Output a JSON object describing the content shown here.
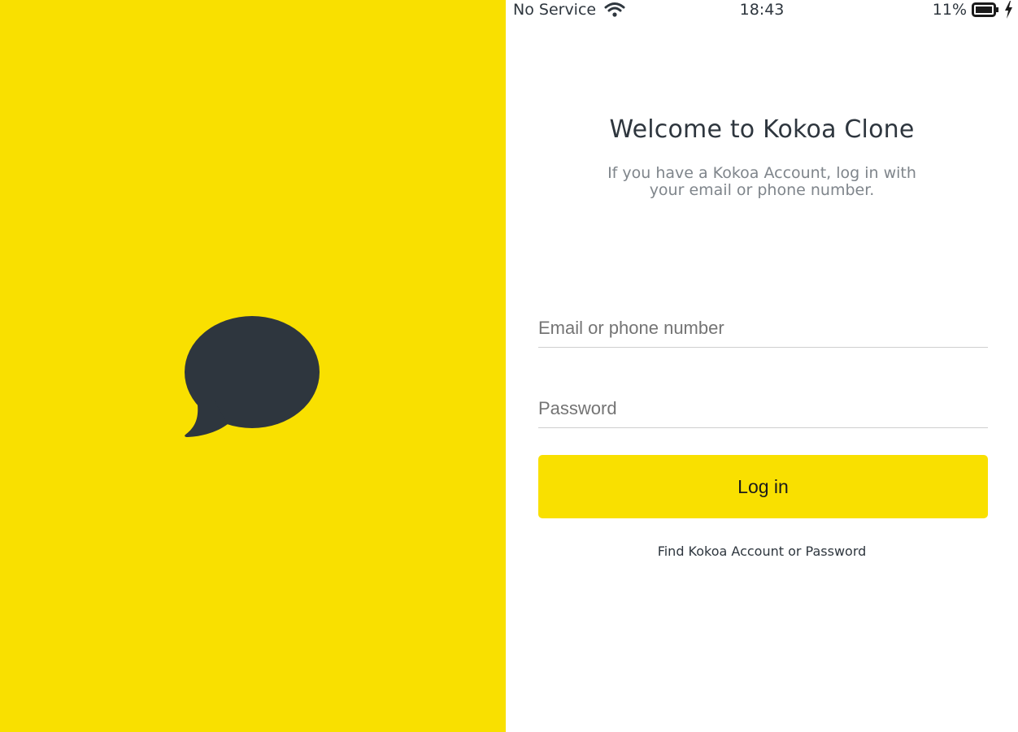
{
  "colors": {
    "brand_yellow": "#f9e000",
    "dark_text": "#2e363e",
    "muted_text": "#7f858b"
  },
  "splash": {
    "logo_icon": "speech-bubble-icon"
  },
  "status_bar": {
    "carrier": "No Service",
    "wifi_icon": "wifi-icon",
    "time": "18:43",
    "battery": "11%",
    "battery_icon": "battery-icon",
    "charging_icon": "lightning-icon"
  },
  "welcome": {
    "title": "Welcome to Kokoa Clone",
    "text": "If you have a Kokoa Account, log in with your email or phone number."
  },
  "form": {
    "email_placeholder": "Email or phone number",
    "email_value": "",
    "password_placeholder": "Password",
    "password_value": "",
    "login_label": "Log in"
  },
  "find_account": {
    "label": "Find Kokoa Account or Password"
  }
}
